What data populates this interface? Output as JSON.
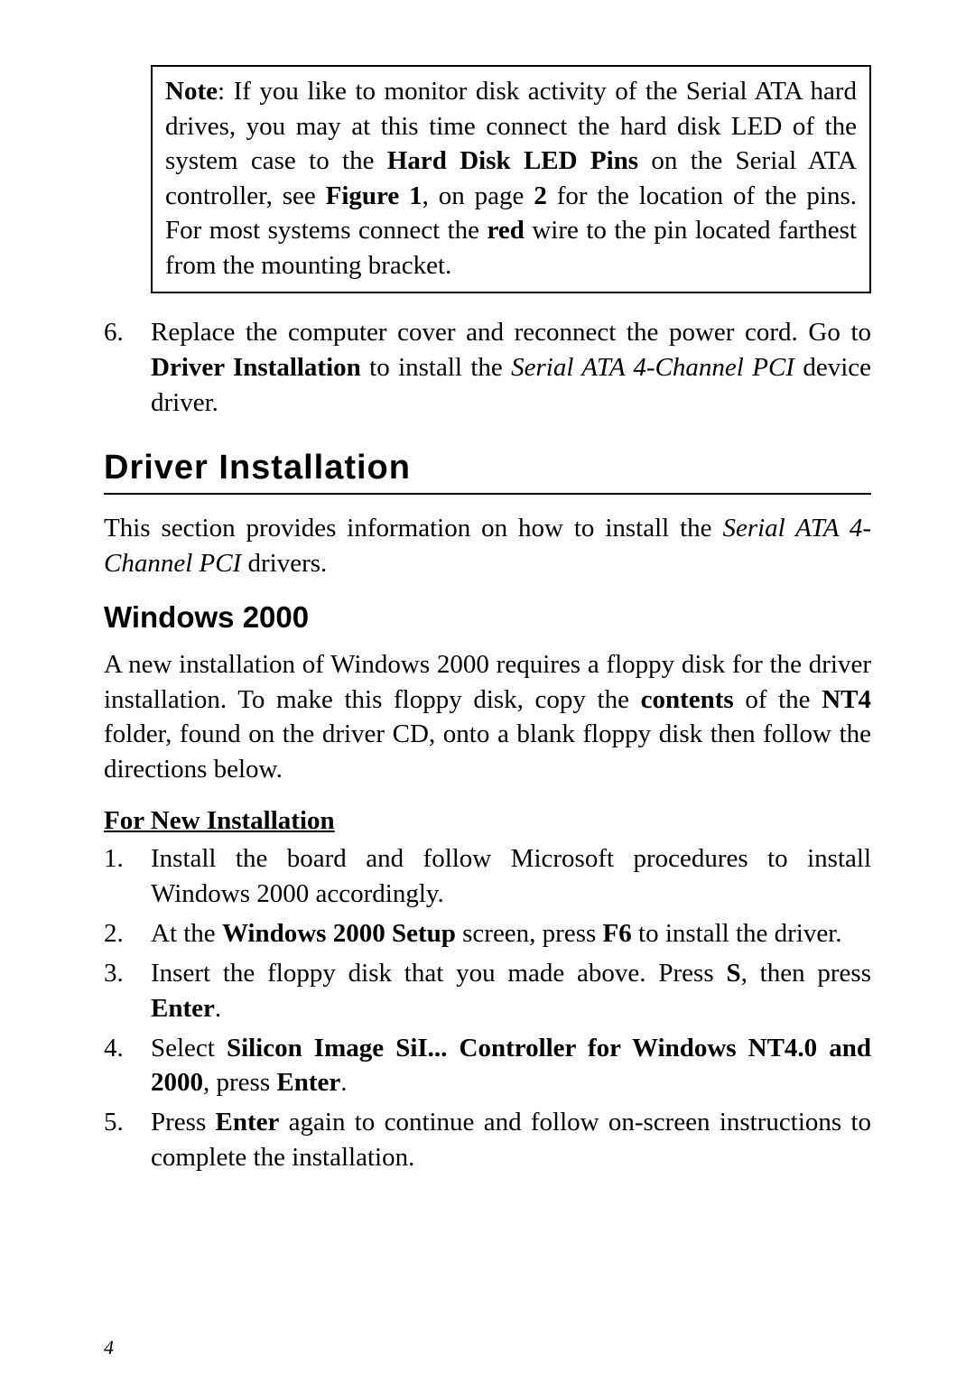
{
  "note": {
    "label": "Note",
    "text_pre": ":   If you like to monitor disk activity of the Serial ATA hard drives, you may at this time connect the hard disk LED of the system case to the ",
    "bold1": "Hard Disk LED Pins",
    "text_mid1": " on the Serial ATA controller, see ",
    "bold2": "Figure 1",
    "text_mid2": ", on page ",
    "bold3": "2",
    "text_mid3": " for the location of the pins.    For most systems connect the ",
    "bold4": "red",
    "text_end": " wire to the pin located farthest from the mounting bracket."
  },
  "step6": {
    "num": "6.",
    "text_pre": "Replace the computer cover and reconnect the power cord.  Go to ",
    "bold1": "Driver Installation",
    "text_mid": " to install the ",
    "italic1": "Serial ATA 4-Channel PCI",
    "text_end": " device driver."
  },
  "section_heading": "Driver  Installation",
  "intro": {
    "text_pre": "This section provides information on how to install the ",
    "italic1": "Serial ATA 4-Channel PCI",
    "text_end": " drivers."
  },
  "subsection": "Windows 2000",
  "win2000_intro": {
    "text_pre": "A new installation of Windows 2000 requires a floppy disk for the driver installation.  To make this floppy disk, copy the ",
    "bold1": "contents",
    "text_mid1": " of the ",
    "bold2": "NT4",
    "text_end": " folder, found on the driver CD, onto a blank floppy disk then follow the directions below."
  },
  "new_install_heading": "For New Installation",
  "steps": {
    "s1": {
      "num": "1.",
      "text": "Install the board and follow Microsoft procedures to install Windows 2000 accordingly."
    },
    "s2": {
      "num": "2.",
      "pre": "At the ",
      "b1": "Windows 2000 Setup",
      "mid": " screen, press ",
      "b2": "F6",
      "end": " to install the driver."
    },
    "s3": {
      "num": "3.",
      "pre": "Insert the floppy disk that you made above.  Press ",
      "b1": "S",
      "mid": ", then press ",
      "b2": "Enter",
      "end": "."
    },
    "s4": {
      "num": "4.",
      "pre": "Select ",
      "b1": "Silicon Image SiI... Controller for Windows NT4.0 and 2000",
      "mid": ", press ",
      "b2": "Enter",
      "end": "."
    },
    "s5": {
      "num": "5.",
      "pre": "Press ",
      "b1": "Enter",
      "end": " again to continue and follow on-screen instructions to complete the installation."
    }
  },
  "page_number": "4"
}
